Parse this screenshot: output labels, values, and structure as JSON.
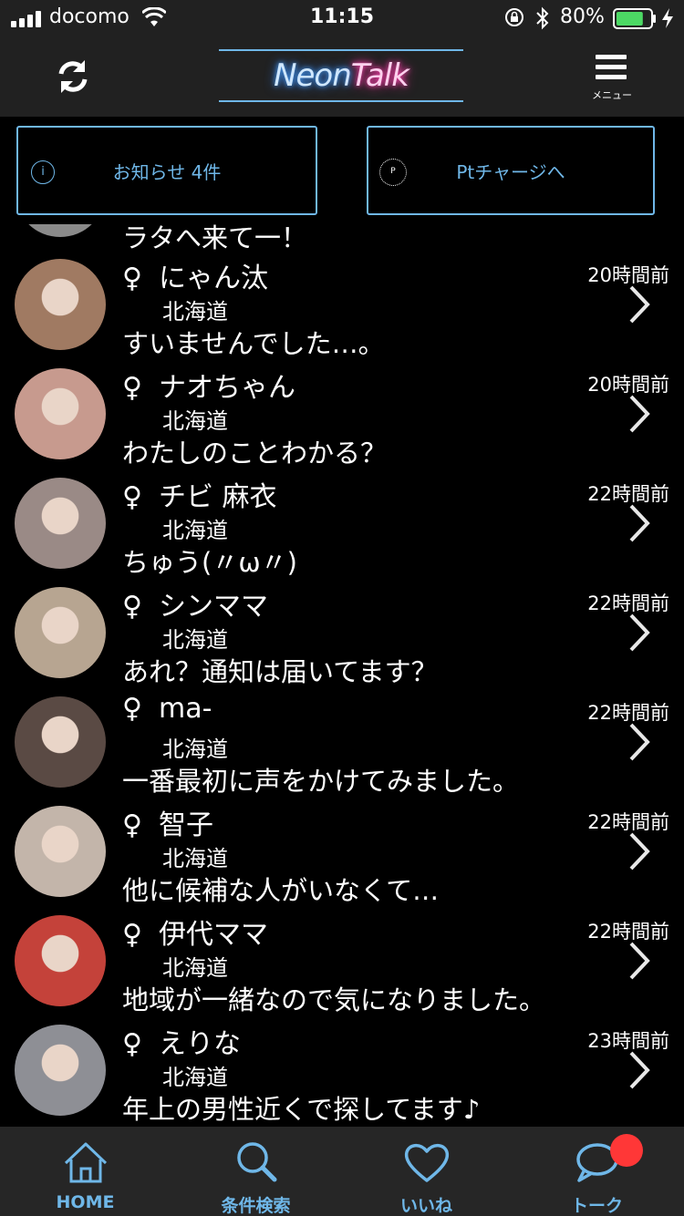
{
  "status_bar": {
    "carrier": "docomo",
    "time": "11:15",
    "battery": "80%",
    "battery_level": 0.8
  },
  "header": {
    "logo_neon": "Neon",
    "logo_talk": "Talk",
    "menu_label": "メニュー",
    "refresh_icon": "refresh-icon",
    "menu_icon": "hamburger-icon"
  },
  "notices": {
    "news_label": "お知らせ 4件",
    "news_icon": "i",
    "charge_label": "Ptチャージへ",
    "charge_icon": "P"
  },
  "partial_row": {
    "message": "ラタへ来て一！"
  },
  "messages": [
    {
      "gender": "♀",
      "name": "にゃん汰",
      "region": "北海道",
      "message": "すいませんでした…。",
      "time_ago": "20時間前",
      "avatar_color": "#a07a62"
    },
    {
      "gender": "♀",
      "name": "ナオちゃん",
      "region": "北海道",
      "message": "わたしのことわかる？",
      "time_ago": "20時間前",
      "avatar_color": "#c79a8e"
    },
    {
      "gender": "♀",
      "name": "チビ 麻衣",
      "region": "北海道",
      "message": "ちゅう(〃ω〃)",
      "time_ago": "22時間前",
      "avatar_color": "#9a8a86"
    },
    {
      "gender": "♀",
      "name": "シンママ",
      "region": "北海道",
      "message": "あれ？通知は届いてます？",
      "time_ago": "22時間前",
      "avatar_color": "#b7a591"
    },
    {
      "gender": "♀",
      "name": "ma-",
      "region": "北海道",
      "message": "一番最初に声をかけてみました。",
      "time_ago": "22時間前",
      "avatar_color": "#5a4a44"
    },
    {
      "gender": "♀",
      "name": "智子",
      "region": "北海道",
      "message": "他に候補な人がいなくて…",
      "time_ago": "22時間前",
      "avatar_color": "#c3b5aa"
    },
    {
      "gender": "♀",
      "name": "伊代ママ",
      "region": "北海道",
      "message": "地域が一緒なので気になりました。",
      "time_ago": "22時間前",
      "avatar_color": "#c4423a"
    },
    {
      "gender": "♀",
      "name": "えりな",
      "region": "北海道",
      "message": "年上の男性近くで探してます♪",
      "time_ago": "23時間前",
      "avatar_color": "#8e8f95"
    }
  ],
  "tabs": [
    {
      "label": "HOME",
      "icon": "home-icon"
    },
    {
      "label": "条件検索",
      "icon": "search-icon"
    },
    {
      "label": "いいね",
      "icon": "heart-icon"
    },
    {
      "label": "トーク",
      "icon": "chat-bubble-icon"
    }
  ],
  "colors": {
    "accent": "#6fb7e8",
    "badge": "#ff3737",
    "battery": "#4cd964",
    "bar_bg": "#212121"
  }
}
